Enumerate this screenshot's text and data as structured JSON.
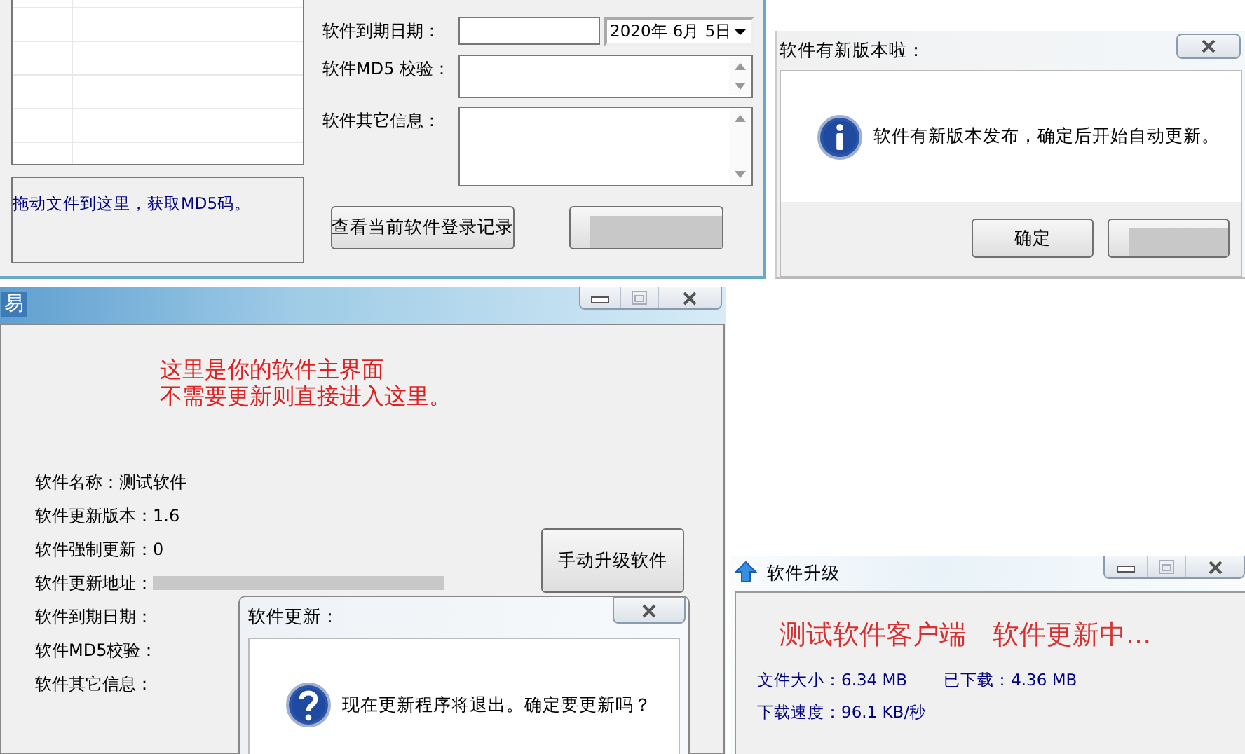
{
  "record_window": {
    "drop_hint": "拖动文件到这里，获取MD5码。",
    "fields": [
      {
        "label": "软件到期日期：",
        "kind": "date",
        "date": "2020年 6月 5日"
      },
      {
        "label": "软件MD5 校验：",
        "kind": "textarea"
      },
      {
        "label": "软件其它信息：",
        "kind": "textarea"
      }
    ],
    "buttons": [
      {
        "kind": "text",
        "label": "查看当前软件登录记录"
      },
      {
        "kind": "redacted"
      }
    ]
  },
  "update_notice": {
    "title": "软件有新版本啦：",
    "message": "软件有新版本发布，确定后开始自动更新。",
    "buttons": [
      {
        "kind": "text",
        "label": "确定"
      },
      {
        "kind": "redacted"
      }
    ]
  },
  "main_window": {
    "app_icon": "易",
    "banner_lines": [
      "这里是你的软件主界面",
      "不需要更新则直接进入这里。"
    ],
    "info_rows": [
      {
        "kind": "text",
        "label": "软件名称：",
        "value": "测试软件"
      },
      {
        "kind": "text",
        "label": "软件更新版本：",
        "value": "1.6"
      },
      {
        "kind": "text",
        "label": "软件强制更新：",
        "value": "0"
      },
      {
        "kind": "redacted",
        "label": "软件更新地址："
      },
      {
        "kind": "text",
        "label": "软件到期日期："
      },
      {
        "kind": "text",
        "label": "软件MD5校验："
      },
      {
        "kind": "text",
        "label": "软件其它信息："
      }
    ],
    "upgrade_button": "手动升级软件"
  },
  "confirm_dialog": {
    "title": "软件更新：",
    "message": "现在更新程序将退出。确定要更新吗？"
  },
  "upgrade_window": {
    "title": "软件升级",
    "status": "测试软件客户端　软件更新中...",
    "stats": [
      [
        "文件大小：6.34 MB",
        "已下载：4.36 MB"
      ],
      [
        "下载速度：96.1 KB/秒"
      ]
    ]
  }
}
